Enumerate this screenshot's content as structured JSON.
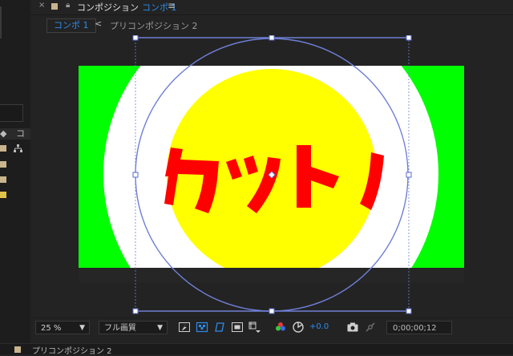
{
  "window_tab": {
    "title": "コンポジション",
    "active_comp": "コンポ 1"
  },
  "breadcrumb": {
    "active": "コンポ 1",
    "other": "プリコンポジション 2"
  },
  "left_panel": {
    "tag_text": "コ"
  },
  "composition": {
    "text": "カットハ",
    "colors": {
      "background": "#00ff00",
      "white_ring": "#ffffff",
      "circle": "#ffff00",
      "text": "#ff0000",
      "handle": "#6f7fd6",
      "footage_dark": "#262626"
    }
  },
  "toolbar": {
    "zoom": "25 %",
    "resolution": "フル画質",
    "exposure": "+0.0",
    "timecode": "0;00;00;12"
  },
  "bottom_panel": {
    "title": "プリコンポジション 2"
  }
}
